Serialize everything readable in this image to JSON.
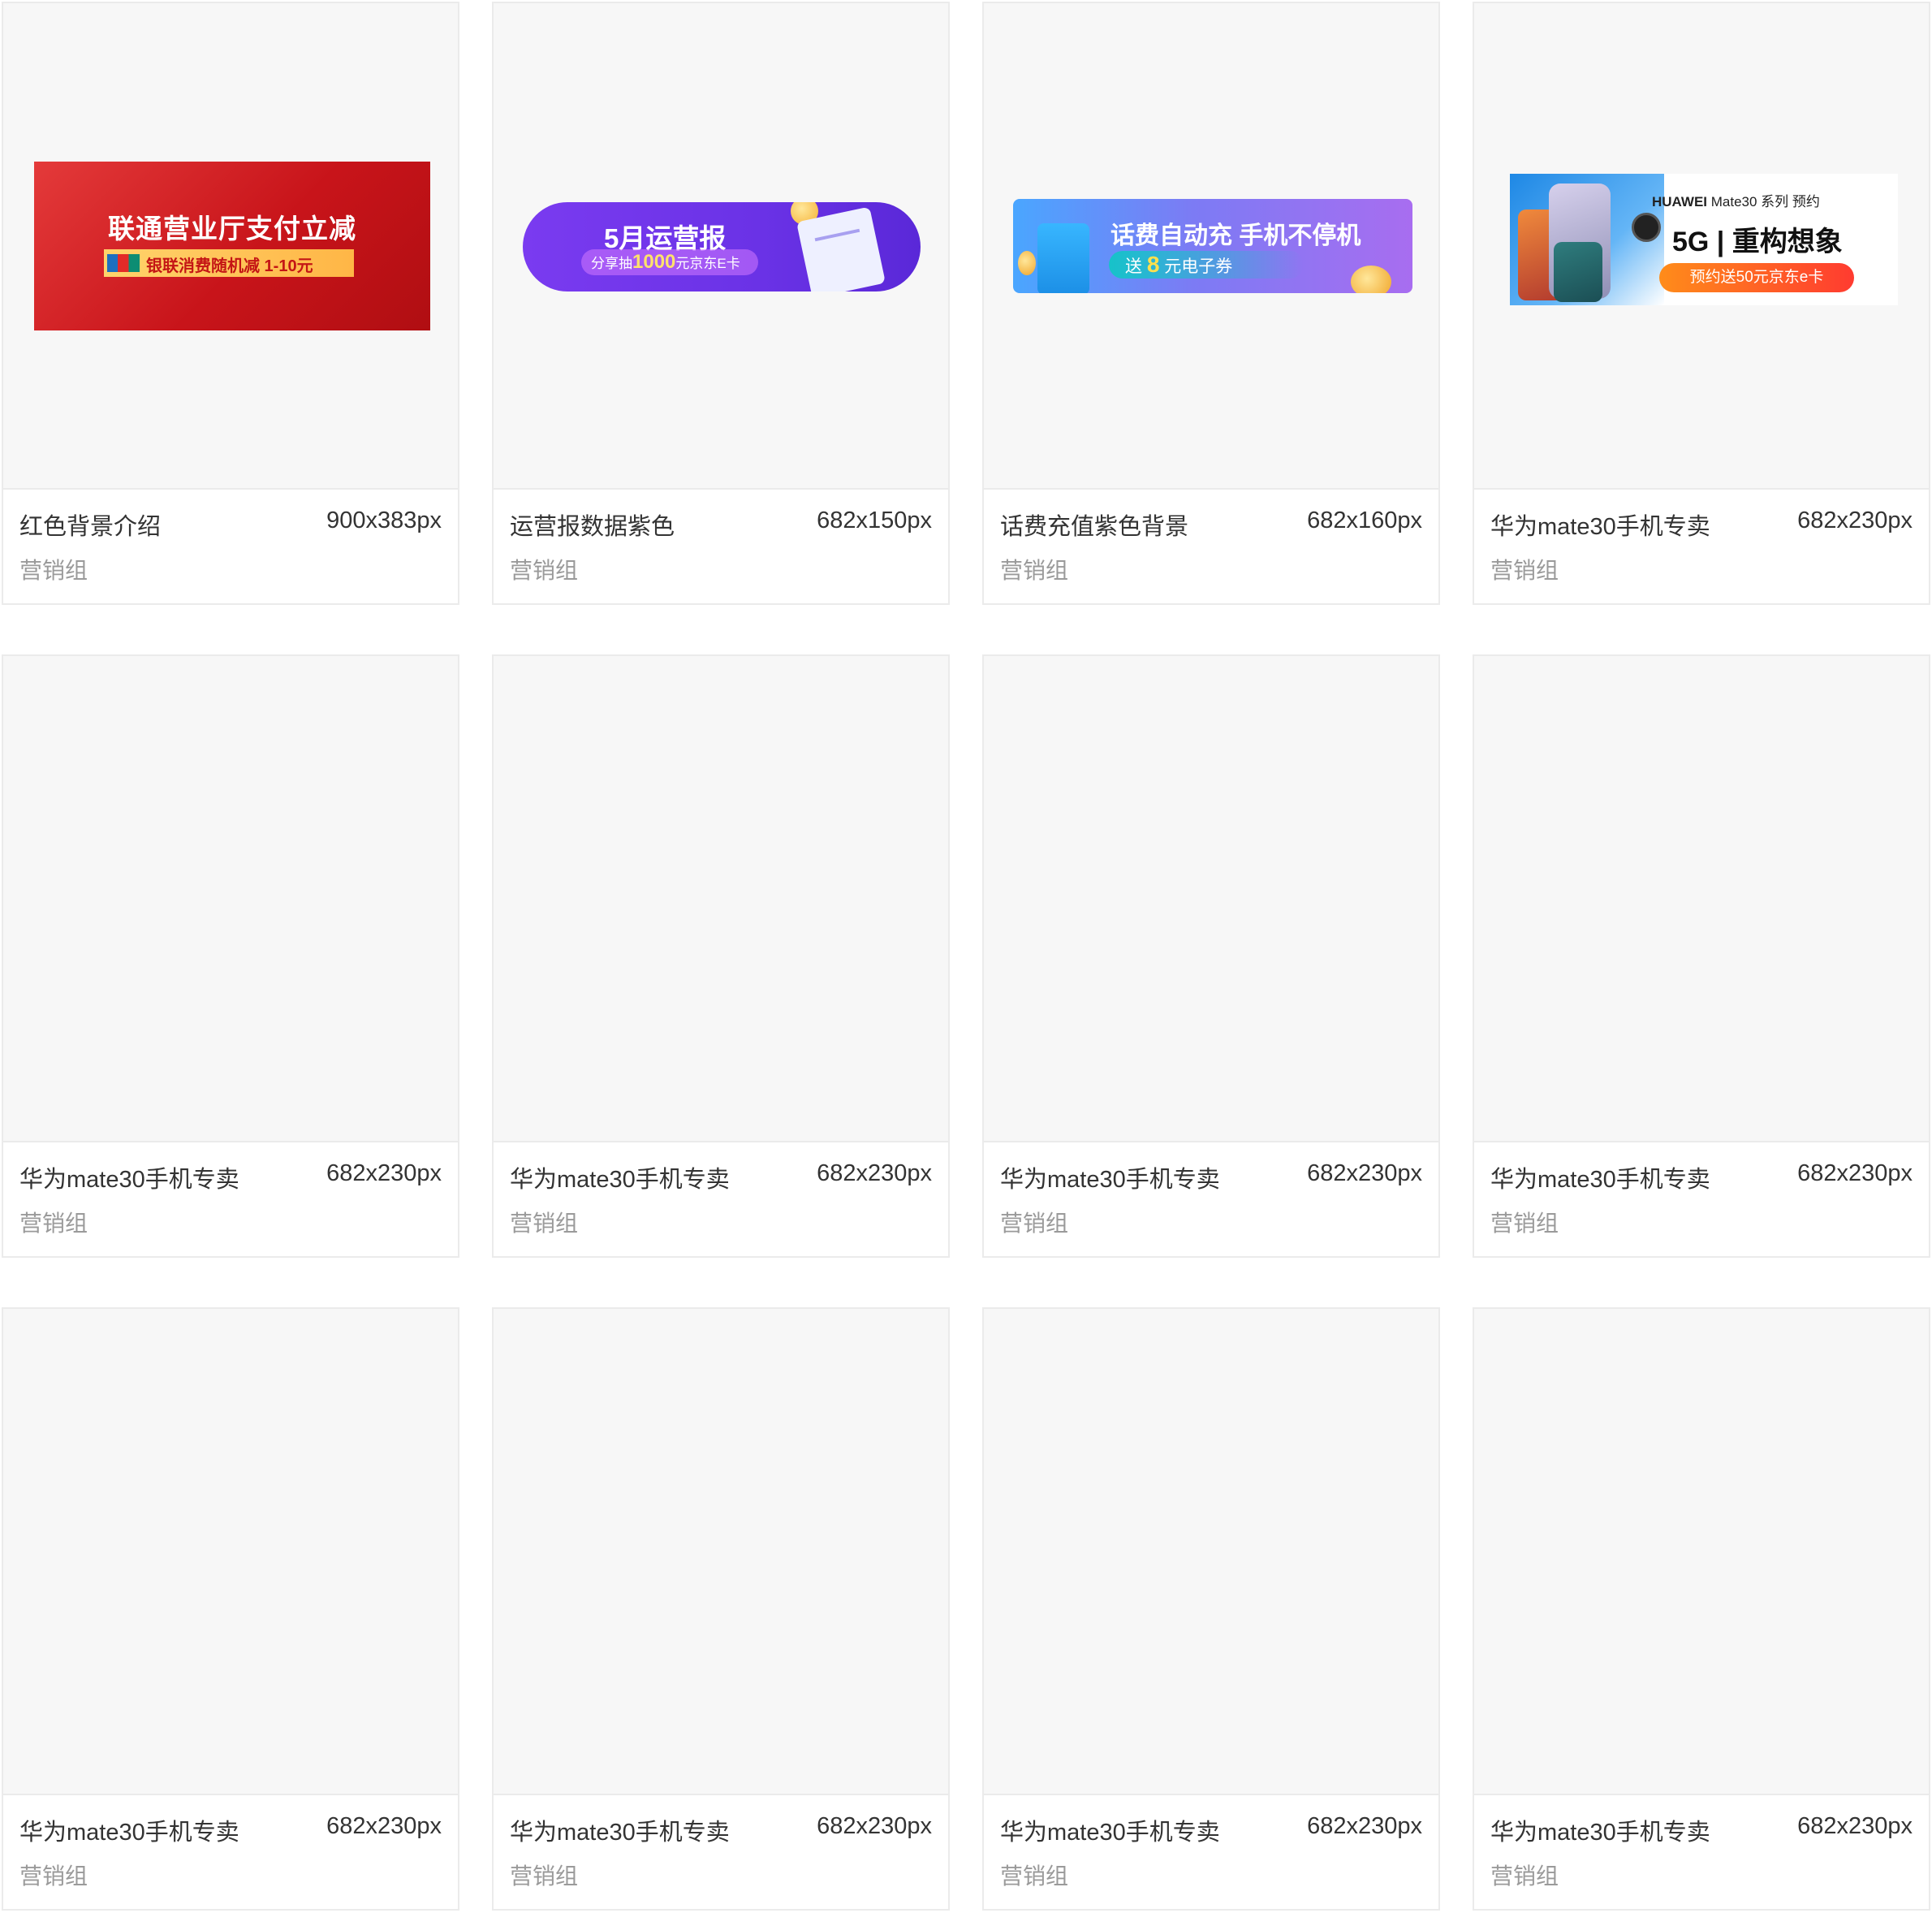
{
  "cards": [
    {
      "title": "红色背景介绍",
      "size": "900x383px",
      "team": "营销组"
    },
    {
      "title": "运营报数据紫色",
      "size": "682x150px",
      "team": "营销组"
    },
    {
      "title": "话费充值紫色背景",
      "size": "682x160px",
      "team": "营销组"
    },
    {
      "title": "华为mate30手机专卖",
      "size": "682x230px",
      "team": "营销组"
    },
    {
      "title": "华为mate30手机专卖",
      "size": "682x230px",
      "team": "营销组"
    },
    {
      "title": "华为mate30手机专卖",
      "size": "682x230px",
      "team": "营销组"
    },
    {
      "title": "华为mate30手机专卖",
      "size": "682x230px",
      "team": "营销组"
    },
    {
      "title": "华为mate30手机专卖",
      "size": "682x230px",
      "team": "营销组"
    },
    {
      "title": "华为mate30手机专卖",
      "size": "682x230px",
      "team": "营销组"
    },
    {
      "title": "华为mate30手机专卖",
      "size": "682x230px",
      "team": "营销组"
    },
    {
      "title": "华为mate30手机专卖",
      "size": "682x230px",
      "team": "营销组"
    },
    {
      "title": "华为mate30手机专卖",
      "size": "682x230px",
      "team": "营销组"
    }
  ],
  "banners": {
    "red": {
      "headline": "联通营业厅支付立减",
      "sub": "银联消费随机减 1-10元"
    },
    "purple": {
      "headline": "5月运营报",
      "sub_prefix": "分享抽",
      "sub_amount": "1000",
      "sub_suffix": "元京东E卡"
    },
    "recharge": {
      "headline": "话费自动充  手机不停机",
      "sub_prefix": "送",
      "sub_amount": "8",
      "sub_suffix": "元电子券"
    },
    "huawei": {
      "brand": "HUAWEI",
      "model": "Mate30 系列 预约",
      "headline": "5G | 重构想象",
      "button": "预约送50元京东e卡"
    }
  },
  "colors": {
    "card_border": "#ebebeb",
    "thumb_bg": "#f7f7f7",
    "title_text": "#333333",
    "team_text": "#9a9a9a"
  }
}
